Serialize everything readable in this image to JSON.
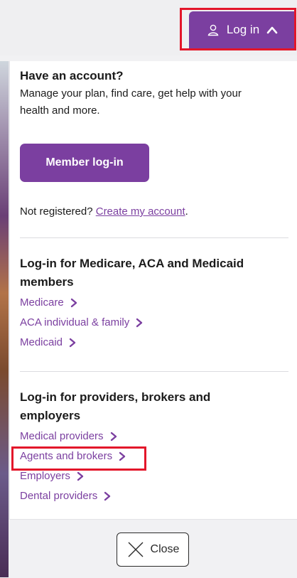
{
  "header": {
    "login_label": "Log in",
    "login_icon": "user-icon",
    "chevron_icon": "chevron-up-icon"
  },
  "account": {
    "heading": "Have an account?",
    "description": "Manage your plan, find care, get help with your health and more.",
    "member_button": "Member log-in",
    "not_registered": "Not registered?",
    "create_link": "Create my account",
    "period": "."
  },
  "members": {
    "heading": "Log-in for Medicare, ACA and Medicaid members",
    "links": [
      "Medicare",
      "ACA individual & family",
      "Medicaid"
    ]
  },
  "providers": {
    "heading": "Log-in for providers, brokers and employers",
    "links": [
      "Medical providers",
      "Agents and brokers",
      "Employers",
      "Dental providers"
    ]
  },
  "footer": {
    "close_label": "Close",
    "close_icon": "close-icon"
  },
  "colors": {
    "brand_purple": "#7b3fa0",
    "highlight_red": "#e3162a",
    "panel_bg": "#ffffff",
    "page_bg": "#f1f1f3"
  }
}
